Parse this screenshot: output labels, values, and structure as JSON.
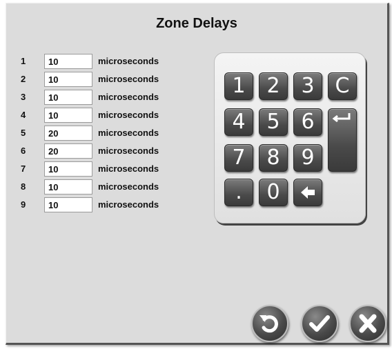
{
  "dialog": {
    "title": "Zone Delays"
  },
  "zones": [
    {
      "label": "1",
      "value": "10",
      "unit": "microseconds"
    },
    {
      "label": "2",
      "value": "10",
      "unit": "microseconds"
    },
    {
      "label": "3",
      "value": "10",
      "unit": "microseconds"
    },
    {
      "label": "4",
      "value": "10",
      "unit": "microseconds"
    },
    {
      "label": "5",
      "value": "20",
      "unit": "microseconds"
    },
    {
      "label": "6",
      "value": "20",
      "unit": "microseconds"
    },
    {
      "label": "7",
      "value": "10",
      "unit": "microseconds"
    },
    {
      "label": "8",
      "value": "10",
      "unit": "microseconds"
    },
    {
      "label": "9",
      "value": "10",
      "unit": "microseconds"
    }
  ],
  "keypad": {
    "k1": "1",
    "k2": "2",
    "k3": "3",
    "clear": "C",
    "k4": "4",
    "k5": "5",
    "k6": "6",
    "k7": "7",
    "k8": "8",
    "k9": "9",
    "dot": ".",
    "k0": "0",
    "backspace_icon": "arrow-left-icon",
    "enter_icon": "enter-icon"
  },
  "actions": {
    "reset_icon": "undo-icon",
    "ok_icon": "checkmark-icon",
    "cancel_icon": "close-x-icon"
  },
  "colors": {
    "dialog_bg": "#dcdcdc",
    "key_bg": "#4a4a4a",
    "key_text": "#ffffff"
  }
}
